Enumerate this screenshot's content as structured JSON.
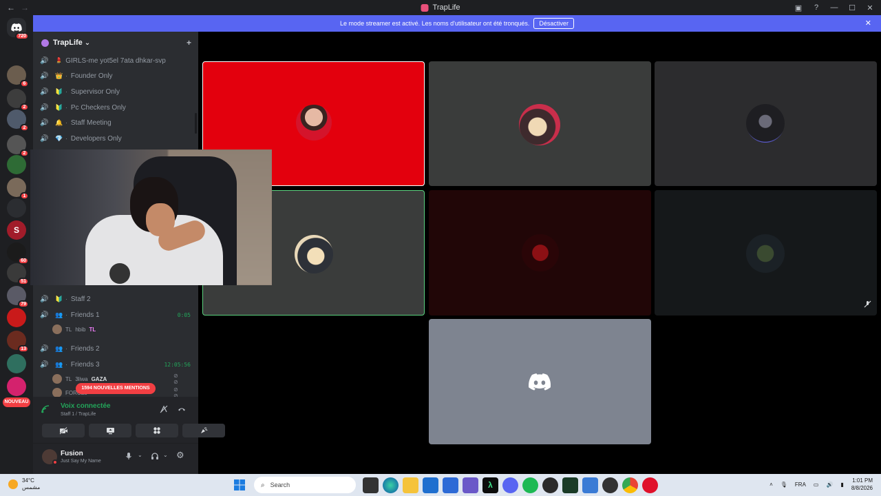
{
  "window": {
    "title": "TrapLife",
    "nav_back": "←",
    "nav_forward": "→",
    "controls": {
      "inbox": "▣",
      "help": "?",
      "minimize": "—",
      "maximize": "☐",
      "close": "✕"
    }
  },
  "banner": {
    "text": "Le mode streamer est activé. Les noms d'utilisateur ont été tronqués.",
    "button": "Désactiver",
    "close": "✕"
  },
  "rail": {
    "home_badge": "720",
    "servers": [
      {
        "badge": "6"
      },
      {
        "badge": "2"
      },
      {
        "badge": "2"
      },
      {
        "badge": "2"
      },
      {
        "badge": ""
      },
      {
        "badge": "1"
      },
      {
        "badge": ""
      },
      {
        "letter": "S",
        "badge": ""
      },
      {
        "badge": "60"
      },
      {
        "badge": "51"
      },
      {
        "badge": "79"
      },
      {
        "badge": ""
      },
      {
        "badge": "13"
      },
      {
        "badge": ""
      },
      {
        "badge": ""
      }
    ],
    "new_label": "NOUVEAU"
  },
  "server": {
    "name": "TrapLife",
    "chevron": "⌄",
    "add_icon": "+"
  },
  "channels": [
    {
      "emoji": "💄",
      "name": "GIRLS-me yot5el 7ata dhkar-svp",
      "active": false
    },
    {
      "emoji": "👑",
      "name": "Founder Only",
      "active": false
    },
    {
      "emoji": "🔰",
      "name": "Supervisor Only",
      "active": false
    },
    {
      "emoji": "🔰",
      "name": "Pc Checkers Only",
      "active": false
    },
    {
      "emoji": "🔔",
      "name": "Staff Meeting",
      "active": false
    },
    {
      "emoji": "💎",
      "name": "Developers Only",
      "active": false
    }
  ],
  "channels_lower": [
    {
      "emoji": "🔰",
      "name": "Staff 2",
      "active": false,
      "timer": ""
    },
    {
      "emoji": "👥",
      "name": "Friends 1",
      "active": true,
      "timer": "0:05"
    },
    {
      "emoji": "👥",
      "name": "Friends 2",
      "active": false,
      "timer": ""
    },
    {
      "emoji": "👥",
      "name": "Friends 3",
      "active": true,
      "timer": "12:05:56"
    }
  ],
  "voice_users": [
    {
      "prefix": "TL",
      "name": "hbib",
      "tag": "TL",
      "extra": ""
    },
    {
      "prefix": "TL",
      "name": "3liwa",
      "tag": "",
      "extra": "GAZA"
    },
    {
      "prefix": "",
      "name": "FORCEJ",
      "tag": "",
      "extra": ""
    }
  ],
  "mentions_pill": "1594 NOUVELLES MENTIONS",
  "voice_panel": {
    "status": "Voix connectée",
    "channel": "Staff 1 / TrapLife",
    "buttons": [
      "camera-off",
      "screen-share",
      "activities",
      "soundboard"
    ]
  },
  "user_panel": {
    "name": "Fusion",
    "status": "Just Say My Name"
  },
  "taskbar": {
    "temperature": "34°C",
    "weather_desc": "مشمس",
    "search": "Search",
    "language": "FRA",
    "time": "1:01 PM",
    "date": "8/8/2026"
  },
  "colors": {
    "blurple": "#5865f2",
    "online_green": "#23a55a",
    "badge_red": "#f23f43",
    "tile_red": "#e3000d",
    "tile_gray": "#3a3c3b",
    "tile_dark": "#2c2c2e",
    "tile_darkred": "#210607",
    "discord_tile": "#7e8490"
  }
}
